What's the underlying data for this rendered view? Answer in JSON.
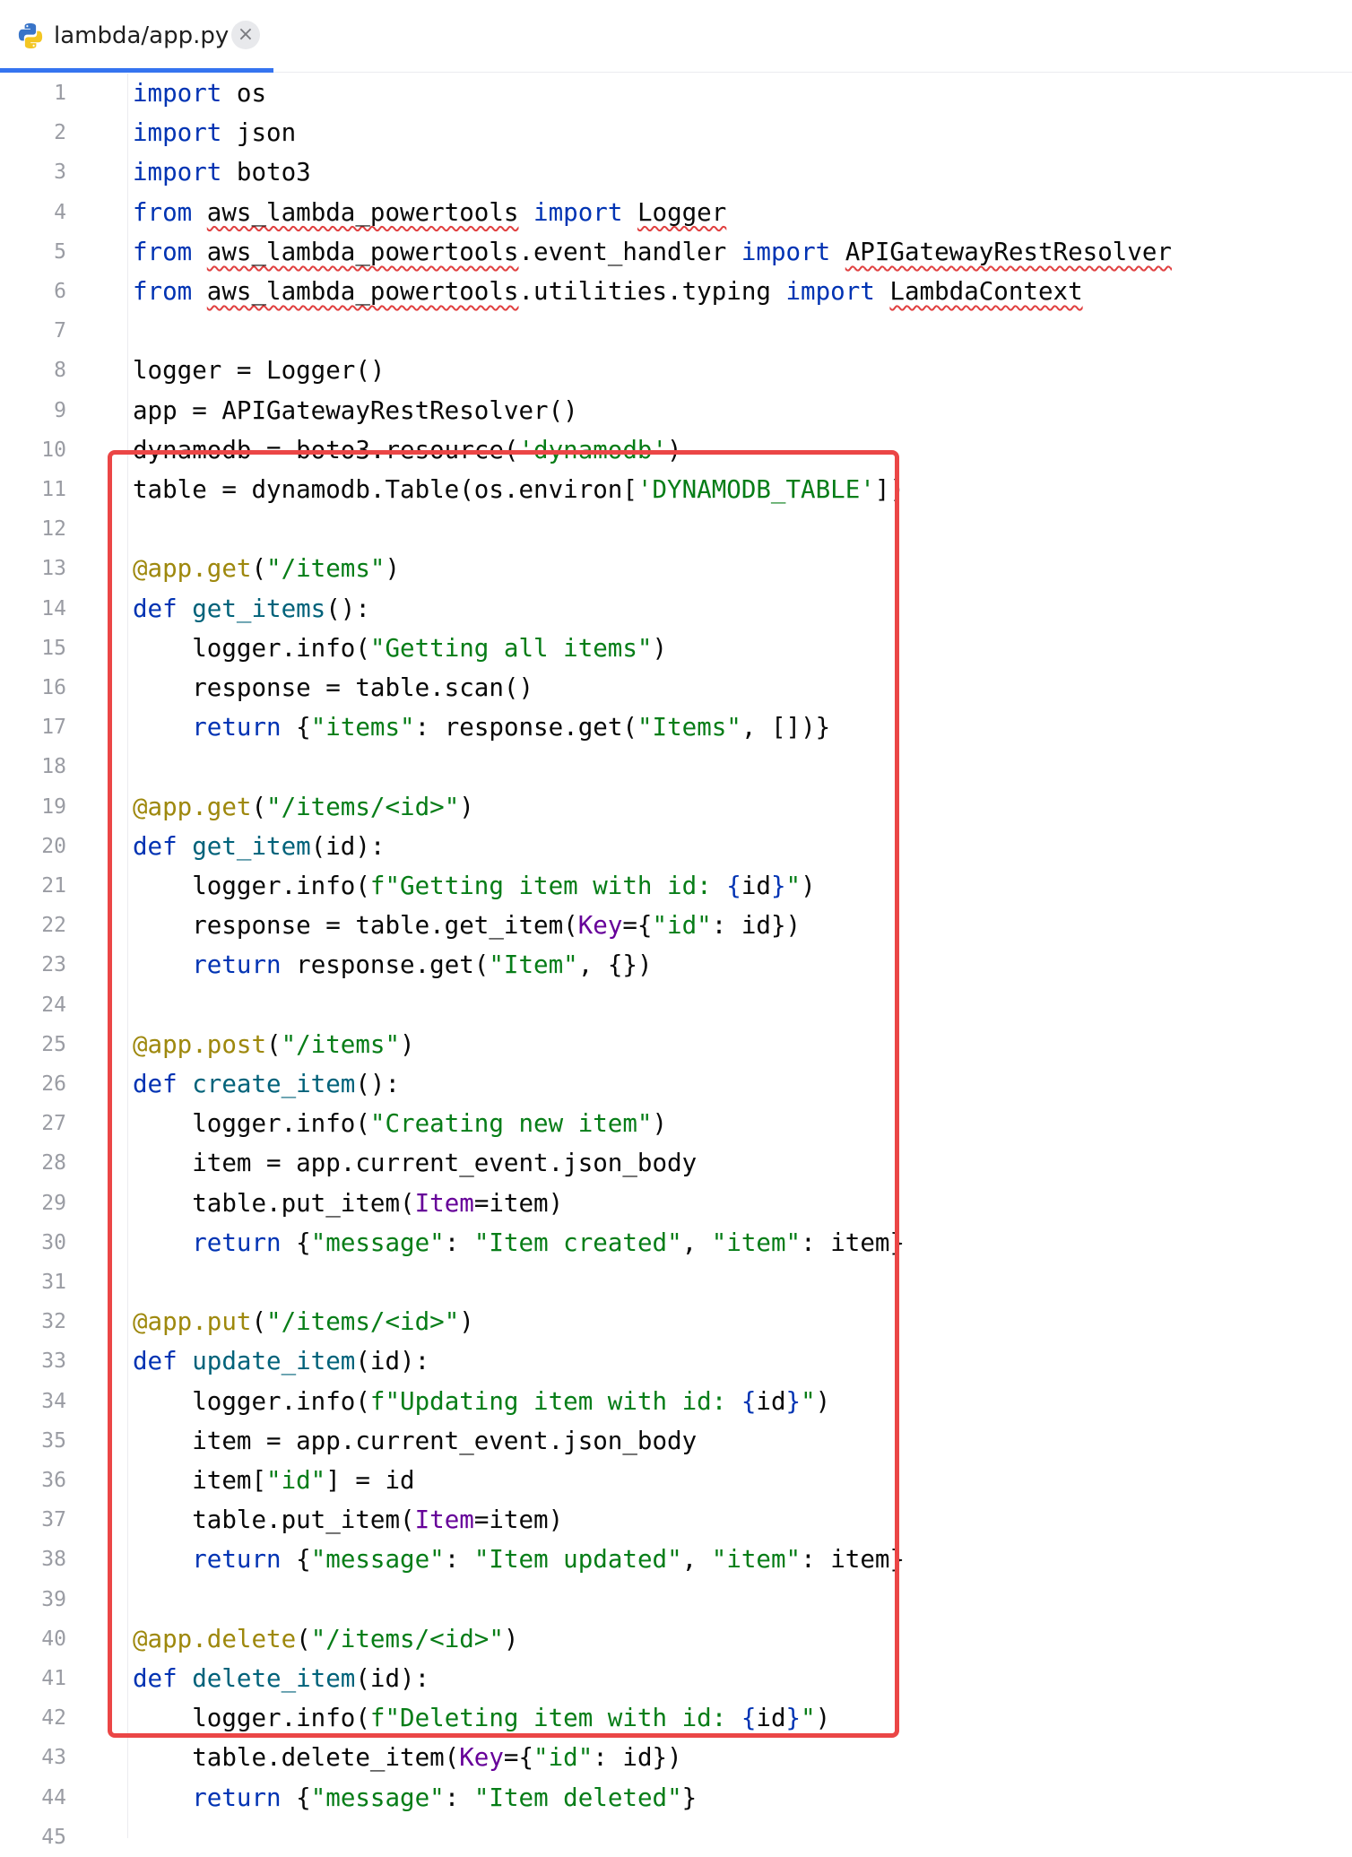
{
  "tab": {
    "title": "lambda/app.py",
    "icon": "python-icon",
    "close": "×"
  },
  "accent_color": "#3574f0",
  "highlight_color": "#eb4646",
  "lines": [
    {
      "n": "1",
      "t": [
        {
          "c": "kw",
          "v": "import"
        },
        {
          "v": " os"
        }
      ]
    },
    {
      "n": "2",
      "t": [
        {
          "c": "kw",
          "v": "import"
        },
        {
          "v": " json"
        }
      ]
    },
    {
      "n": "3",
      "t": [
        {
          "c": "kw",
          "v": "import"
        },
        {
          "v": " boto3"
        }
      ]
    },
    {
      "n": "4",
      "t": [
        {
          "c": "kw",
          "v": "from"
        },
        {
          "v": " "
        },
        {
          "c": "sq",
          "v": "aws_lambda_powertools"
        },
        {
          "v": " "
        },
        {
          "c": "kw",
          "v": "import"
        },
        {
          "v": " "
        },
        {
          "c": "sq",
          "v": "Logger"
        }
      ]
    },
    {
      "n": "5",
      "t": [
        {
          "c": "kw",
          "v": "from"
        },
        {
          "v": " "
        },
        {
          "c": "sq",
          "v": "aws_lambda_powertools"
        },
        {
          "v": ".event_handler "
        },
        {
          "c": "kw",
          "v": "import"
        },
        {
          "v": " "
        },
        {
          "c": "sq",
          "v": "APIGatewayRestResolver"
        }
      ]
    },
    {
      "n": "6",
      "t": [
        {
          "c": "kw",
          "v": "from"
        },
        {
          "v": " "
        },
        {
          "c": "sq",
          "v": "aws_lambda_powertools"
        },
        {
          "v": ".utilities.typing "
        },
        {
          "c": "kw",
          "v": "import"
        },
        {
          "v": " "
        },
        {
          "c": "sq",
          "v": "LambdaContext"
        }
      ]
    },
    {
      "n": "7",
      "t": []
    },
    {
      "n": "8",
      "t": [
        {
          "v": "logger = Logger()"
        }
      ]
    },
    {
      "n": "9",
      "t": [
        {
          "v": "app = APIGatewayRestResolver()"
        }
      ]
    },
    {
      "n": "10",
      "t": [
        {
          "v": "dynamodb = boto3.resource("
        },
        {
          "c": "str",
          "v": "'dynamodb'"
        },
        {
          "v": ")"
        }
      ]
    },
    {
      "n": "11",
      "t": [
        {
          "v": "table = dynamodb.Table(os.environ["
        },
        {
          "c": "str",
          "v": "'DYNAMODB_TABLE'"
        },
        {
          "v": "])"
        }
      ]
    },
    {
      "n": "12",
      "t": []
    },
    {
      "n": "13",
      "t": [
        {
          "c": "dec",
          "v": "@app.get"
        },
        {
          "v": "("
        },
        {
          "c": "str",
          "v": "\"/items\""
        },
        {
          "v": ")"
        }
      ]
    },
    {
      "n": "14",
      "t": [
        {
          "c": "kw",
          "v": "def"
        },
        {
          "v": " "
        },
        {
          "c": "fn",
          "v": "get_items"
        },
        {
          "v": "():"
        }
      ]
    },
    {
      "n": "15",
      "t": [
        {
          "v": "    logger.info("
        },
        {
          "c": "str",
          "v": "\"Getting all items\""
        },
        {
          "v": ")"
        }
      ]
    },
    {
      "n": "16",
      "t": [
        {
          "v": "    response = table.scan()"
        }
      ]
    },
    {
      "n": "17",
      "t": [
        {
          "v": "    "
        },
        {
          "c": "kw",
          "v": "return"
        },
        {
          "v": " {"
        },
        {
          "c": "str",
          "v": "\"items\""
        },
        {
          "v": ": response.get("
        },
        {
          "c": "str",
          "v": "\"Items\""
        },
        {
          "v": ", [])}"
        }
      ]
    },
    {
      "n": "18",
      "t": []
    },
    {
      "n": "19",
      "t": [
        {
          "c": "dec",
          "v": "@app.get"
        },
        {
          "v": "("
        },
        {
          "c": "str",
          "v": "\"/items/<id>\""
        },
        {
          "v": ")"
        }
      ]
    },
    {
      "n": "20",
      "t": [
        {
          "c": "kw",
          "v": "def"
        },
        {
          "v": " "
        },
        {
          "c": "fn",
          "v": "get_item"
        },
        {
          "v": "(id):"
        }
      ]
    },
    {
      "n": "21",
      "t": [
        {
          "v": "    logger.info("
        },
        {
          "c": "str",
          "v": "f\"Getting item with id: "
        },
        {
          "c": "kw",
          "v": "{"
        },
        {
          "v": "id"
        },
        {
          "c": "kw",
          "v": "}"
        },
        {
          "c": "str",
          "v": "\""
        },
        {
          "v": ")"
        }
      ]
    },
    {
      "n": "22",
      "t": [
        {
          "v": "    response = table.get_item("
        },
        {
          "c": "kwarg",
          "v": "Key"
        },
        {
          "v": "={"
        },
        {
          "c": "str",
          "v": "\"id\""
        },
        {
          "v": ": id})"
        }
      ]
    },
    {
      "n": "23",
      "t": [
        {
          "v": "    "
        },
        {
          "c": "kw",
          "v": "return"
        },
        {
          "v": " response.get("
        },
        {
          "c": "str",
          "v": "\"Item\""
        },
        {
          "v": ", {})"
        }
      ]
    },
    {
      "n": "24",
      "t": []
    },
    {
      "n": "25",
      "t": [
        {
          "c": "dec",
          "v": "@app.post"
        },
        {
          "v": "("
        },
        {
          "c": "str",
          "v": "\"/items\""
        },
        {
          "v": ")"
        }
      ]
    },
    {
      "n": "26",
      "t": [
        {
          "c": "kw",
          "v": "def"
        },
        {
          "v": " "
        },
        {
          "c": "fn",
          "v": "create_item"
        },
        {
          "v": "():"
        }
      ]
    },
    {
      "n": "27",
      "t": [
        {
          "v": "    logger.info("
        },
        {
          "c": "str",
          "v": "\"Creating new item\""
        },
        {
          "v": ")"
        }
      ]
    },
    {
      "n": "28",
      "t": [
        {
          "v": "    item = app.current_event.json_body"
        }
      ]
    },
    {
      "n": "29",
      "t": [
        {
          "v": "    table.put_item("
        },
        {
          "c": "kwarg",
          "v": "Item"
        },
        {
          "v": "=item)"
        }
      ]
    },
    {
      "n": "30",
      "t": [
        {
          "v": "    "
        },
        {
          "c": "kw",
          "v": "return"
        },
        {
          "v": " {"
        },
        {
          "c": "str",
          "v": "\"message\""
        },
        {
          "v": ": "
        },
        {
          "c": "str",
          "v": "\"Item created\""
        },
        {
          "v": ", "
        },
        {
          "c": "str",
          "v": "\"item\""
        },
        {
          "v": ": item}"
        }
      ]
    },
    {
      "n": "31",
      "t": []
    },
    {
      "n": "32",
      "t": [
        {
          "c": "dec",
          "v": "@app.put"
        },
        {
          "v": "("
        },
        {
          "c": "str",
          "v": "\"/items/<id>\""
        },
        {
          "v": ")"
        }
      ]
    },
    {
      "n": "33",
      "t": [
        {
          "c": "kw",
          "v": "def"
        },
        {
          "v": " "
        },
        {
          "c": "fn",
          "v": "update_item"
        },
        {
          "v": "(id):"
        }
      ]
    },
    {
      "n": "34",
      "t": [
        {
          "v": "    logger.info("
        },
        {
          "c": "str",
          "v": "f\"Updating item with id: "
        },
        {
          "c": "kw",
          "v": "{"
        },
        {
          "v": "id"
        },
        {
          "c": "kw",
          "v": "}"
        },
        {
          "c": "str",
          "v": "\""
        },
        {
          "v": ")"
        }
      ]
    },
    {
      "n": "35",
      "t": [
        {
          "v": "    item = app.current_event.json_body"
        }
      ]
    },
    {
      "n": "36",
      "t": [
        {
          "v": "    item["
        },
        {
          "c": "str",
          "v": "\"id\""
        },
        {
          "v": "] = id"
        }
      ]
    },
    {
      "n": "37",
      "t": [
        {
          "v": "    table.put_item("
        },
        {
          "c": "kwarg",
          "v": "Item"
        },
        {
          "v": "=item)"
        }
      ]
    },
    {
      "n": "38",
      "t": [
        {
          "v": "    "
        },
        {
          "c": "kw",
          "v": "return"
        },
        {
          "v": " {"
        },
        {
          "c": "str",
          "v": "\"message\""
        },
        {
          "v": ": "
        },
        {
          "c": "str",
          "v": "\"Item updated\""
        },
        {
          "v": ", "
        },
        {
          "c": "str",
          "v": "\"item\""
        },
        {
          "v": ": item}"
        }
      ]
    },
    {
      "n": "39",
      "t": []
    },
    {
      "n": "40",
      "t": [
        {
          "c": "dec",
          "v": "@app.delete"
        },
        {
          "v": "("
        },
        {
          "c": "str",
          "v": "\"/items/<id>\""
        },
        {
          "v": ")"
        }
      ]
    },
    {
      "n": "41",
      "t": [
        {
          "c": "kw",
          "v": "def"
        },
        {
          "v": " "
        },
        {
          "c": "fn",
          "v": "delete_item"
        },
        {
          "v": "(id):"
        }
      ]
    },
    {
      "n": "42",
      "t": [
        {
          "v": "    logger.info("
        },
        {
          "c": "str",
          "v": "f\"Deleting item with id: "
        },
        {
          "c": "kw",
          "v": "{"
        },
        {
          "v": "id"
        },
        {
          "c": "kw",
          "v": "}"
        },
        {
          "c": "str",
          "v": "\""
        },
        {
          "v": ")"
        }
      ]
    },
    {
      "n": "43",
      "t": [
        {
          "v": "    table.delete_item("
        },
        {
          "c": "kwarg",
          "v": "Key"
        },
        {
          "v": "={"
        },
        {
          "c": "str",
          "v": "\"id\""
        },
        {
          "v": ": id})"
        }
      ]
    },
    {
      "n": "44",
      "t": [
        {
          "v": "    "
        },
        {
          "c": "kw",
          "v": "return"
        },
        {
          "v": " {"
        },
        {
          "c": "str",
          "v": "\"message\""
        },
        {
          "v": ": "
        },
        {
          "c": "str",
          "v": "\"Item deleted\""
        },
        {
          "v": "}"
        }
      ]
    },
    {
      "n": "45",
      "t": []
    }
  ]
}
